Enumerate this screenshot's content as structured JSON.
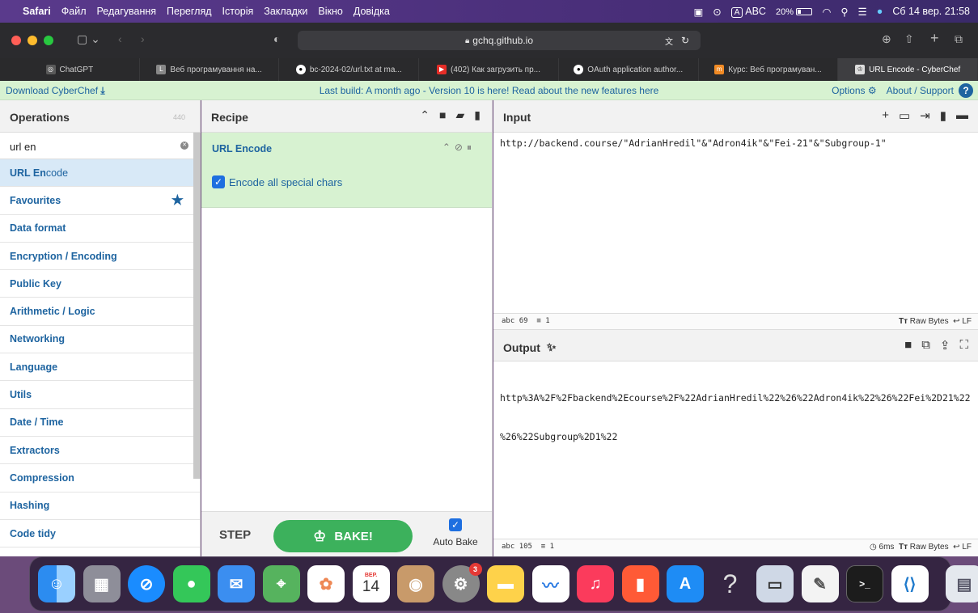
{
  "menubar": {
    "app": "Safari",
    "items": [
      "Файл",
      "Редагування",
      "Перегляд",
      "Історія",
      "Закладки",
      "Вікно",
      "Довідка"
    ],
    "input_source": "A",
    "input_label": "ABC",
    "battery": "20%",
    "datetime": "Сб 14 вер.  21:58"
  },
  "browser": {
    "address": "gchq.github.io",
    "tabs": [
      {
        "label": "ChatGPT",
        "icon": "chatgpt-icon",
        "color": "#5a5a5a"
      },
      {
        "label": "Веб програмування на...",
        "icon": "l-icon",
        "color": "#888888"
      },
      {
        "label": "bc-2024-02/url.txt at ma...",
        "icon": "github-icon",
        "color": "#ffffff"
      },
      {
        "label": "(402) Как загрузить пр...",
        "icon": "youtube-icon",
        "color": "#e52d27"
      },
      {
        "label": "OAuth application author...",
        "icon": "github-icon",
        "color": "#ffffff"
      },
      {
        "label": "Курс: Веб програмуван...",
        "icon": "m-icon",
        "color": "#f08a24"
      },
      {
        "label": "URL Encode - CyberChef",
        "icon": "chef-icon",
        "color": "#dddddd"
      }
    ]
  },
  "banner": {
    "download": "Download CyberChef",
    "message": "Last build: A month ago - Version 10 is here! Read about the new features here",
    "options": "Options",
    "about": "About / Support"
  },
  "operations": {
    "title": "Operations",
    "count": "440",
    "search_value": "url en",
    "result_prefix": "URL En",
    "result_suffix": "code",
    "categories": [
      "Favourites",
      "Data format",
      "Encryption / Encoding",
      "Public Key",
      "Arithmetic / Logic",
      "Networking",
      "Language",
      "Utils",
      "Date / Time",
      "Extractors",
      "Compression",
      "Hashing",
      "Code tidy"
    ]
  },
  "recipe": {
    "title": "Recipe",
    "ingredient": "URL Encode",
    "option_label": "Encode all special chars",
    "step": "STEP",
    "bake": "BAKE!",
    "auto_bake": "Auto Bake"
  },
  "input": {
    "title": "Input",
    "text": "http://backend.course/\"AdrianHredil\"&\"Adron4ik\"&\"Fei-21\"&\"Subgroup-1\"",
    "length": "69",
    "lines": "1",
    "format": "Raw Bytes",
    "eol": "LF"
  },
  "output": {
    "title": "Output",
    "line1": "http%3A%2F%2Fbackend%2Ecourse%2F%22AdrianHredil%22%26%22Adron4ik%22%26%22Fei%2D21%22",
    "line2": "%26%22Subgroup%2D1%22",
    "length": "105",
    "lines": "1",
    "time": "6ms",
    "format": "Raw Bytes",
    "eol": "LF"
  },
  "dock": {
    "calendar_month": "ВЕР.",
    "calendar_day": "14",
    "settings_badge": "3",
    "help_glyph": "?"
  }
}
